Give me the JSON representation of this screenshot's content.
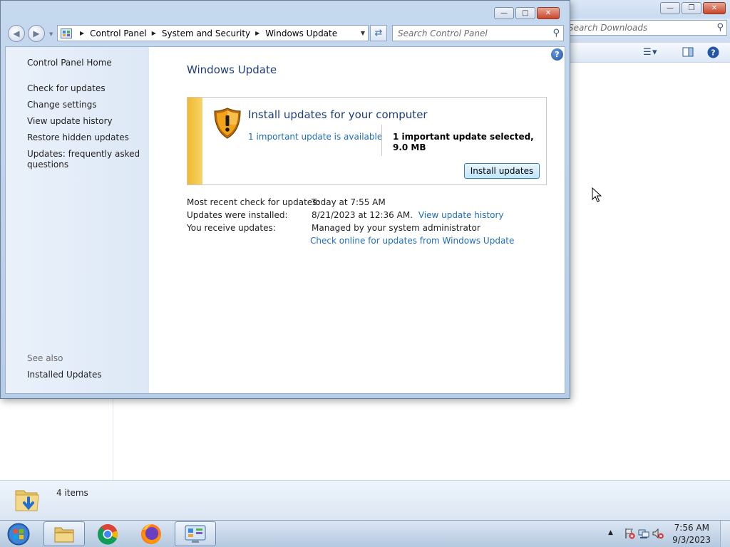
{
  "background_window": {
    "search_placeholder": "Search Downloads",
    "status_text": "4 items"
  },
  "window": {
    "breadcrumbs": [
      "Control Panel",
      "System and Security",
      "Windows Update"
    ],
    "search_placeholder": "Search Control Panel"
  },
  "sidebar": {
    "home": "Control Panel Home",
    "items": [
      "Check for updates",
      "Change settings",
      "View update history",
      "Restore hidden updates",
      "Updates: frequently asked questions"
    ],
    "see_also_heading": "See also",
    "see_also_items": [
      "Installed Updates"
    ]
  },
  "main": {
    "title": "Windows Update",
    "update_box": {
      "headline": "Install updates for your computer",
      "available_link": "1 important update is available",
      "selected_text": "1 important update selected, 9.0 MB",
      "install_button": "Install updates",
      "accent_color": "#f1b92d"
    },
    "info": [
      {
        "label": "Most recent check for updates:",
        "value": "Today at 7:55 AM",
        "link": ""
      },
      {
        "label": "Updates were installed:",
        "value": "8/21/2023 at 12:36 AM.",
        "link": "View update history"
      },
      {
        "label": "You receive updates:",
        "value": "Managed by your system administrator",
        "link": ""
      }
    ],
    "check_online_link": "Check online for updates from Windows Update"
  },
  "taskbar": {
    "apps": [
      "start-orb",
      "file-explorer",
      "chrome",
      "firefox",
      "control-panel"
    ],
    "time": "7:56 AM",
    "date": "9/3/2023"
  },
  "colors": {
    "link": "#1f6bbd",
    "title": "#1e3e7b"
  }
}
